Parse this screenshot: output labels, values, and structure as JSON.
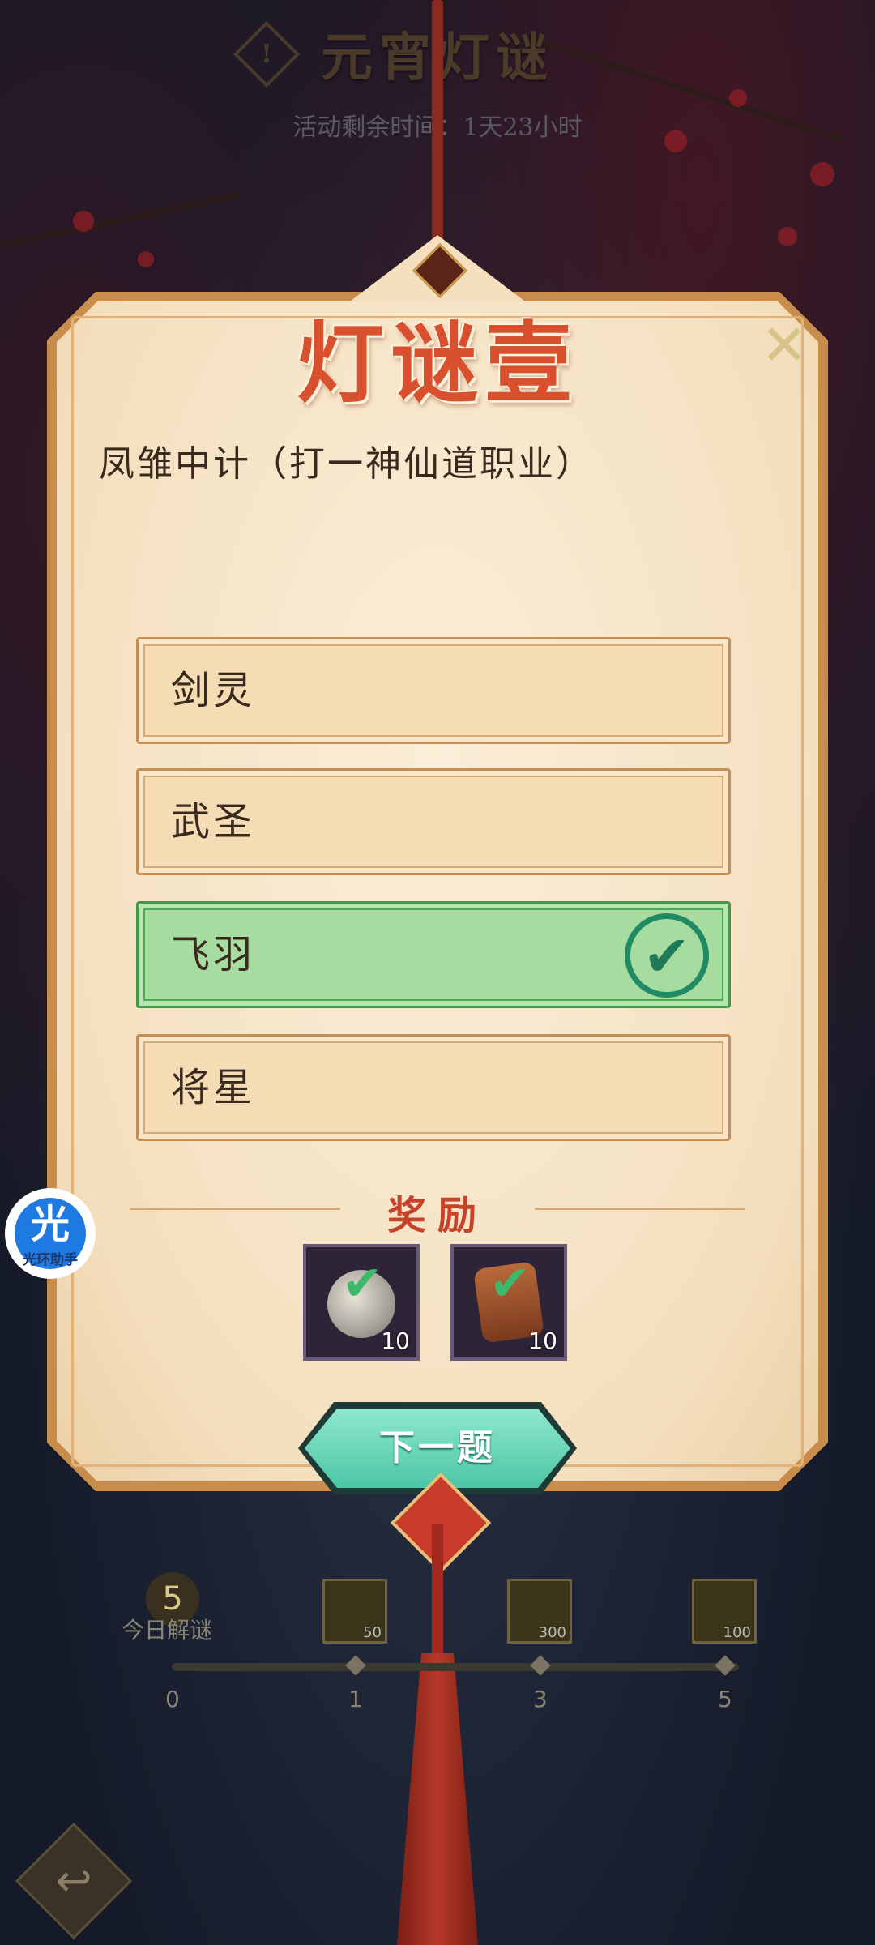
{
  "header": {
    "title": "元宵灯谜",
    "remaining_time": "活动剩余时间：1天23小时"
  },
  "card": {
    "title": "灯谜壹",
    "question": "凤雏中计（打一神仙道职业）",
    "options": [
      {
        "label": "剑灵",
        "state": "normal"
      },
      {
        "label": "武圣",
        "state": "normal"
      },
      {
        "label": "飞羽",
        "state": "correct"
      },
      {
        "label": "将星",
        "state": "normal"
      }
    ],
    "reward_title": "奖励",
    "rewards": [
      {
        "icon": "silver-orb-icon",
        "count": "10"
      },
      {
        "icon": "scroll-icon",
        "count": "10"
      }
    ],
    "next_button": "下一题"
  },
  "assistant": {
    "glyph": "光",
    "label": "光环助手"
  },
  "progress": {
    "solved_count": "5",
    "solved_label": "今日解谜",
    "milestones": [
      "0",
      "1",
      "3",
      "5"
    ],
    "chest_counts": [
      "50",
      "300",
      "100"
    ]
  },
  "colors": {
    "correct_green": "#a6dca0",
    "title_red": "#d9502e",
    "card_bg": "#f4dfbe"
  }
}
